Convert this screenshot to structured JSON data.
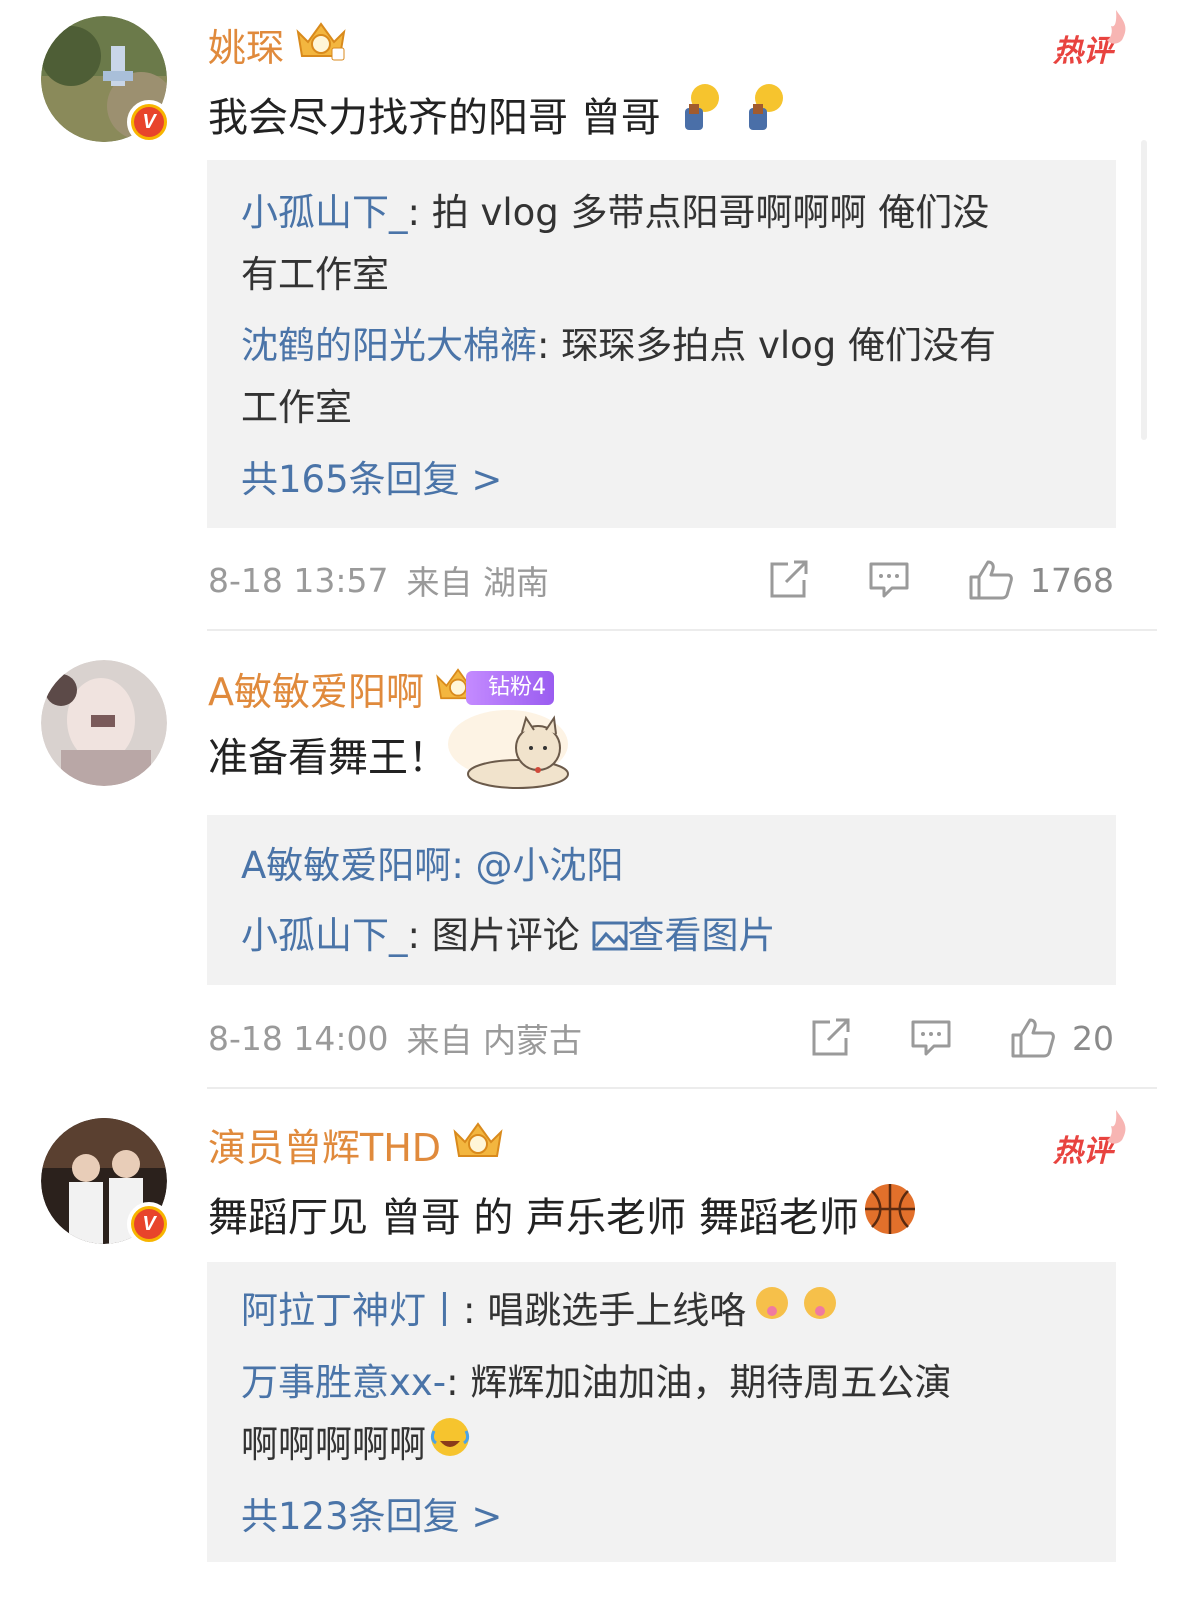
{
  "comments": [
    {
      "username": "姚琛",
      "hot_label": "热评",
      "text": "我会尽力找齐的阳哥 曾哥",
      "replies": [
        {
          "name": "小孤山下_",
          "text": ": 拍 vlog 多带点阳哥啊啊啊 俺们没",
          "text2": "有工作室"
        },
        {
          "name": "沈鹤的阳光大棉裤",
          "text": ": 琛琛多拍点 vlog 俺们没有",
          "text2": "工作室"
        }
      ],
      "more_replies": "共165条回复 >",
      "time": "8-18 13:57",
      "location": "来自 湖南",
      "likes": "1768"
    },
    {
      "username": "A敏敏爱阳啊",
      "fan_badge": "钻粉4",
      "text": "准备看舞王！",
      "replies": [
        {
          "name": "A敏敏爱阳啊",
          "text": ": @小沈阳"
        },
        {
          "name": "小孤山下_",
          "text": ": 图片评论 ",
          "link": "查看图片"
        }
      ],
      "time": "8-18 14:00",
      "location": "来自 内蒙古",
      "likes": "20"
    },
    {
      "username": "演员曾辉THD",
      "hot_label": "热评",
      "text": "舞蹈厅见  曾哥 的 声乐老师 舞蹈老师",
      "replies": [
        {
          "name": "阿拉丁神灯丨",
          "text": ": 唱跳选手上线咯"
        },
        {
          "name": "万事胜意xx-",
          "text": ": 辉辉加油加油，期待周五公演",
          "text2": "啊啊啊啊啊"
        }
      ],
      "more_replies": "共123条回复 >"
    }
  ],
  "colors": {
    "username": "#e08a3c",
    "reply_name": "#4a74a8",
    "hot": "#e8433f",
    "meta": "#9a9a9a",
    "reply_bg": "#f2f2f2"
  },
  "icons": [
    "share-icon",
    "comment-icon",
    "like-icon",
    "crown-icon",
    "verified-icon",
    "flame-icon",
    "image-icon"
  ]
}
